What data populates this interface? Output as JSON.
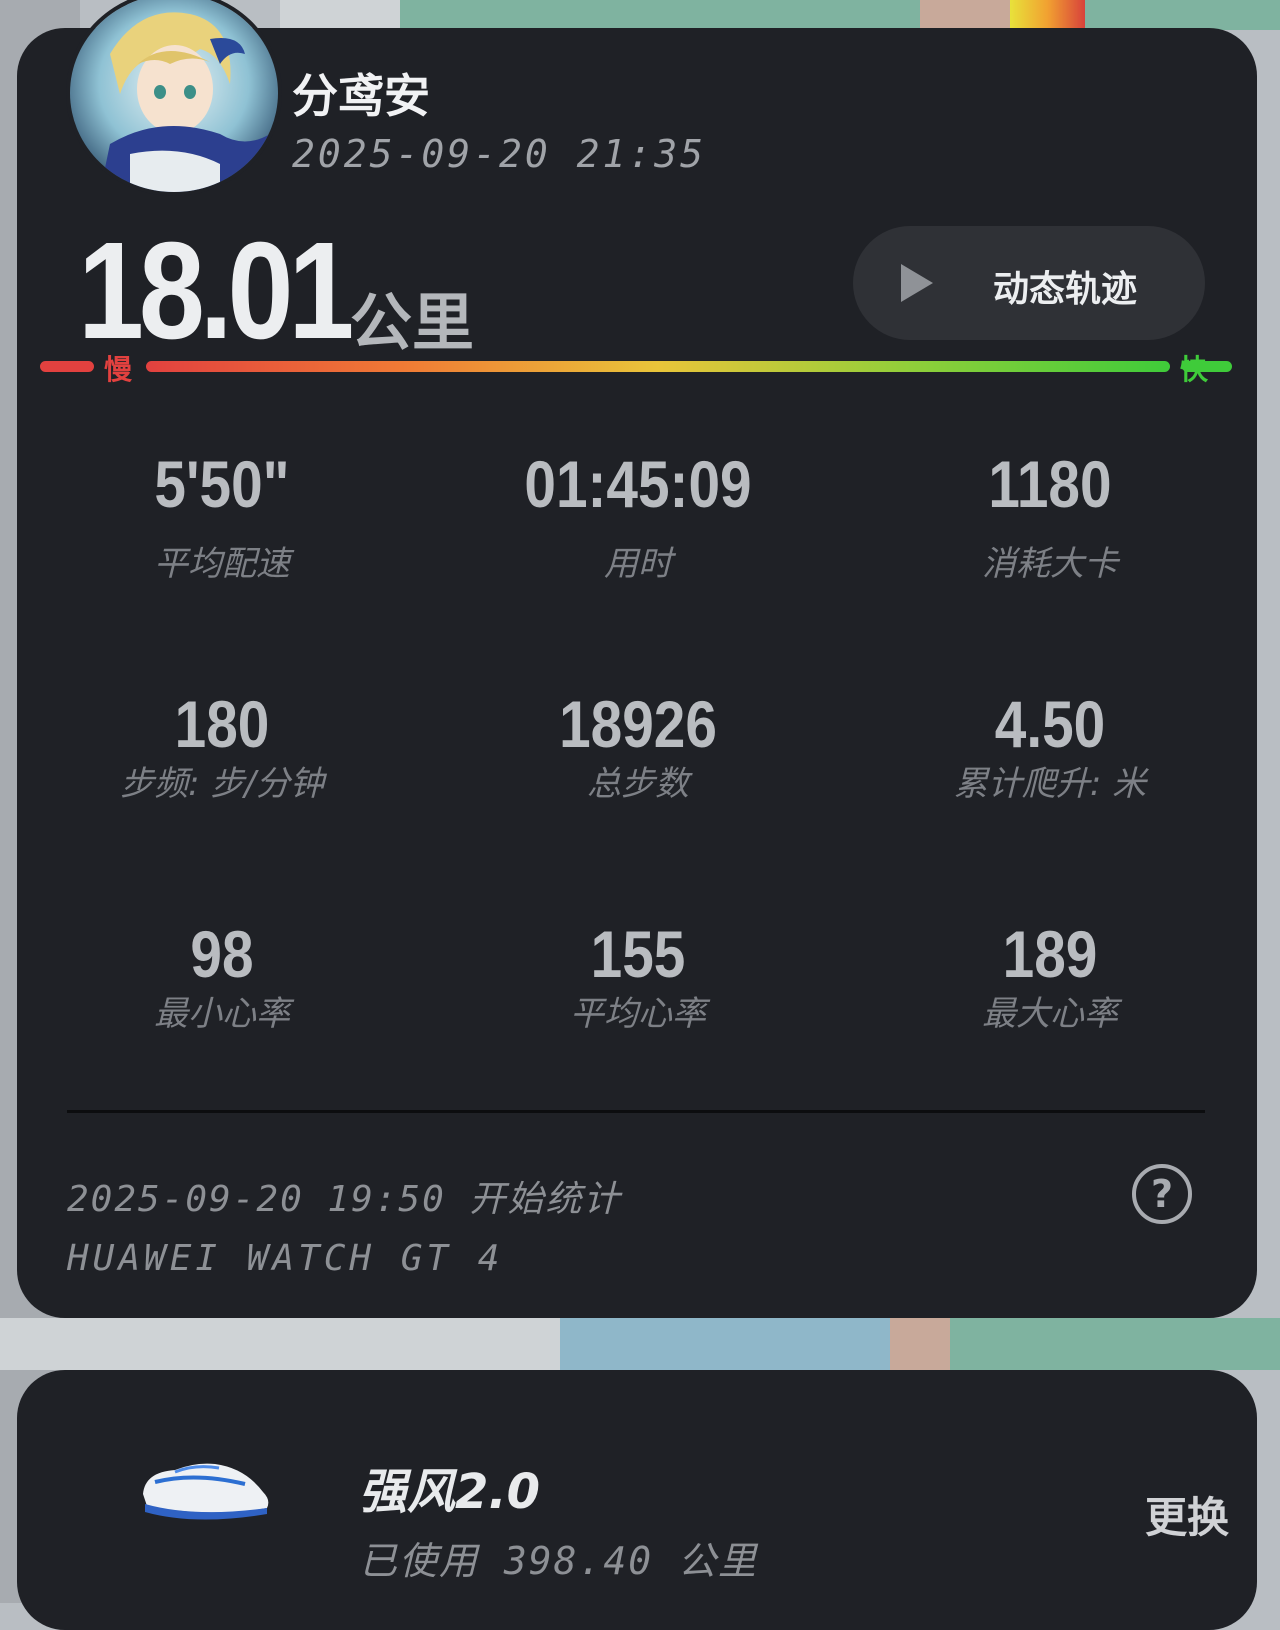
{
  "colors": {
    "card_bg": "#1f2126",
    "slow": "#e2413f",
    "fast": "#3fcb3a",
    "value_text": "#b9bcc0",
    "label_text": "#7d8086"
  },
  "user": {
    "name": "分鸢安",
    "datetime": "2025-09-20 21:35",
    "avatar_icon": "avatar-icon"
  },
  "summary": {
    "distance": "18.01",
    "unit": "公里"
  },
  "track_button": {
    "icon": "play-icon",
    "label": "动态轨迹"
  },
  "speed_legend": {
    "slow": "慢",
    "fast": "快"
  },
  "stats": [
    {
      "value": "5'50\"",
      "label": "平均配速"
    },
    {
      "value": "01:45:09",
      "label": "用时"
    },
    {
      "value": "1180",
      "label": "消耗大卡"
    },
    {
      "value": "180",
      "label": "步频: 步/分钟"
    },
    {
      "value": "18926",
      "label": "总步数"
    },
    {
      "value": "4.50",
      "label": "累计爬升: 米"
    },
    {
      "value": "98",
      "label": "最小心率"
    },
    {
      "value": "155",
      "label": "平均心率"
    },
    {
      "value": "189",
      "label": "最大心率"
    }
  ],
  "footer": {
    "start": "2025-09-20 19:50 开始统计",
    "device": "HUAWEI WATCH GT 4",
    "help_icon": "?"
  },
  "shoe": {
    "name": "强风2.0",
    "used": "已使用 398.40 公里",
    "change": "更换"
  }
}
